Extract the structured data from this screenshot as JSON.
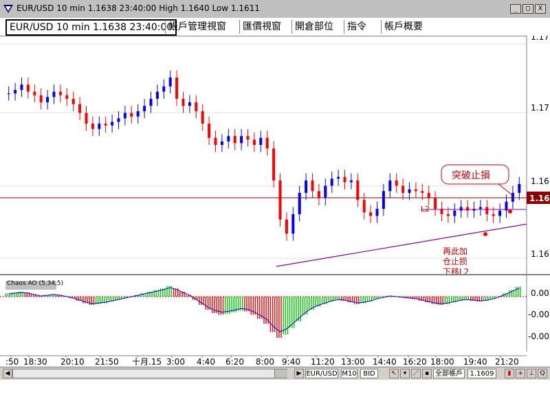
{
  "window": {
    "title": "EUR/USD 10 min 1.1638 23:40:00 High 1.1640 Low 1.1611",
    "min_label": "_",
    "max_label": "□",
    "close_label": "X"
  },
  "tabs": [
    {
      "label": "EUR/USD 10 min 1.1638 23:40:00"
    },
    {
      "label": "帳戶管理視窗"
    },
    {
      "label": "匯價視窗"
    },
    {
      "label": "開倉部位"
    },
    {
      "label": "指令"
    },
    {
      "label": "帳戶概要"
    }
  ],
  "chart": {
    "price_labels": [
      "1.17",
      "1.17",
      "1.16",
      "1.16"
    ],
    "current_price_label": "1.16",
    "annotation_breakout": "突破止損",
    "annotation_l2": "L2",
    "annotation_note": [
      "再此加",
      "仓止损",
      "下移L2"
    ],
    "indicator_name": "Chaos AO (5,34,5)",
    "indicator_labels": [
      "0.00",
      "-0.00",
      "-0.00"
    ],
    "time_labels": [
      ":50",
      "18:30",
      "20:10",
      "21:50",
      "十月.15",
      "3:00",
      "4:40",
      "6:20",
      "8:00",
      "9:40",
      "11:20",
      "13:00",
      "14:40",
      "16:20",
      "18:00",
      "19:40",
      "21:20"
    ]
  },
  "statusbar": {
    "symbol": "EUR/USD",
    "interval": "M10",
    "side": "BID",
    "account": "全部帳戶",
    "price": "1.1609",
    "q_label": "Q"
  },
  "colors": {
    "up": "#0000ff",
    "down": "#ff0000",
    "ao_up": "#00cc00",
    "ao_down": "#ff0000",
    "trendline": "#8b008b",
    "hline": "#8b0000"
  },
  "chart_data": {
    "type": "candlestick",
    "title": "",
    "ylim": [
      1.159,
      1.172
    ],
    "close_series": [
      1.1689,
      1.1691,
      1.1694,
      1.169,
      1.1688,
      1.1684,
      1.1687,
      1.169,
      1.1688,
      1.1686,
      1.1683,
      1.1678,
      1.1672,
      1.1669,
      1.1672,
      1.1671,
      1.1673,
      1.1675,
      1.1678,
      1.1676,
      1.1679,
      1.1682,
      1.1686,
      1.169,
      1.1693,
      1.1698,
      1.1686,
      1.1682,
      1.1684,
      1.1679,
      1.1672,
      1.1664,
      1.166,
      1.1662,
      1.1665,
      1.1661,
      1.1665,
      1.1663,
      1.166,
      1.1664,
      1.1658,
      1.164,
      1.1618,
      1.161,
      1.1621,
      1.1633,
      1.164,
      1.1634,
      1.163,
      1.1637,
      1.1641,
      1.1642,
      1.1639,
      1.164,
      1.1629,
      1.1622,
      1.162,
      1.1624,
      1.1634,
      1.164,
      1.1637,
      1.1633,
      1.1635,
      1.1634,
      1.1633,
      1.163,
      1.1624,
      1.1621,
      1.162,
      1.1623,
      1.1625,
      1.1623,
      1.1624,
      1.1625,
      1.1621,
      1.162,
      1.1623,
      1.1628,
      1.1633,
      1.1638
    ],
    "ao_values": [
      0.4,
      0.5,
      0.6,
      0.5,
      0.3,
      0.1,
      0.2,
      0.3,
      0.2,
      0.0,
      -0.2,
      -0.5,
      -0.8,
      -1.0,
      -0.9,
      -0.8,
      -0.6,
      -0.4,
      -0.2,
      0.0,
      0.2,
      0.4,
      0.6,
      0.8,
      1.0,
      1.3,
      1.0,
      0.6,
      0.2,
      -0.4,
      -1.0,
      -1.6,
      -2.0,
      -2.2,
      -2.1,
      -1.9,
      -1.7,
      -1.8,
      -2.2,
      -2.7,
      -3.3,
      -4.3,
      -5.0,
      -4.6,
      -3.8,
      -3.0,
      -2.2,
      -1.6,
      -1.2,
      -0.9,
      -0.6,
      -0.4,
      -0.5,
      -0.7,
      -0.9,
      -0.8,
      -0.6,
      -0.3,
      -0.1,
      0.1,
      0.0,
      -0.1,
      -0.2,
      -0.3,
      -0.5,
      -0.7,
      -0.9,
      -1.0,
      -0.9,
      -0.7,
      -0.5,
      -0.4,
      -0.5,
      -0.6,
      -0.5,
      -0.3,
      0.0,
      0.4,
      0.8,
      1.2
    ]
  }
}
